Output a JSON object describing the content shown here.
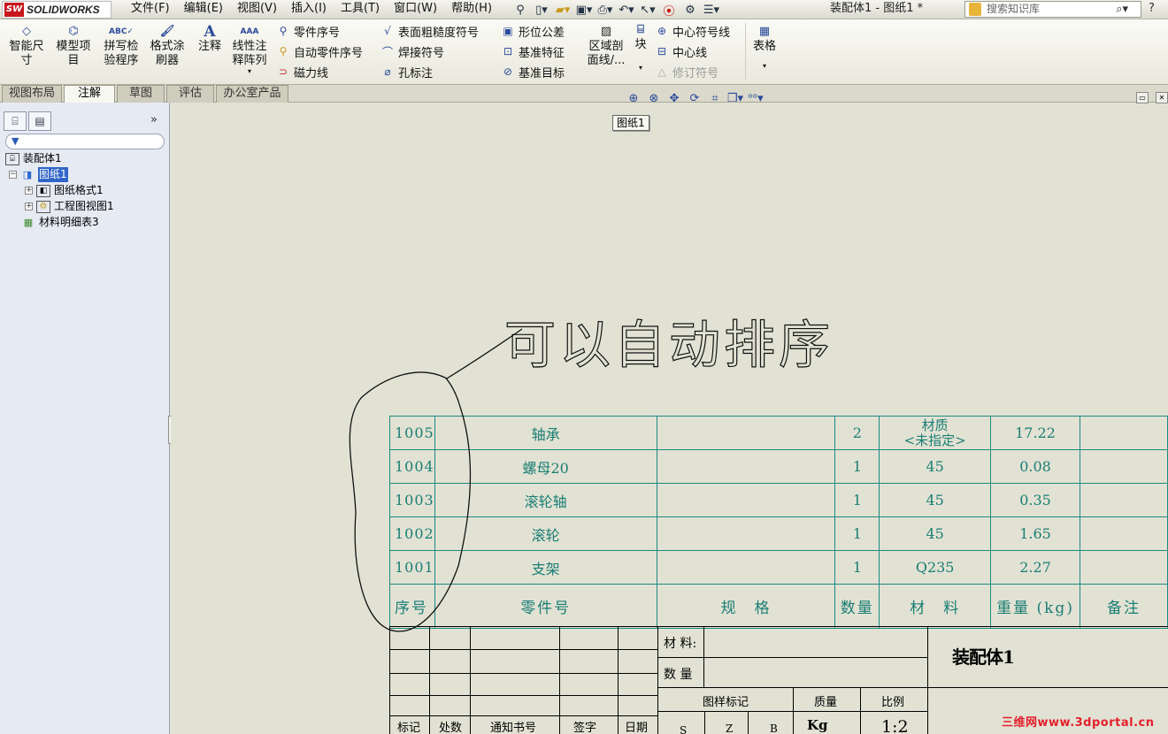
{
  "app": {
    "name": "SOLIDWORKS",
    "logo_badge": "SW"
  },
  "menu": [
    "文件(F)",
    "编辑(E)",
    "视图(V)",
    "插入(I)",
    "工具(T)",
    "窗口(W)",
    "帮助(H)"
  ],
  "quick_toolbar_icons": [
    "pin-icon",
    "new-document-icon",
    "open-icon",
    "save-icon",
    "print-icon",
    "undo-icon",
    "select-icon",
    "traffic-light-icon",
    "options-icon",
    "file-properties-icon"
  ],
  "document_title": "装配体1 - 图纸1 *",
  "search": {
    "placeholder": "搜索知识库"
  },
  "help_label": "?",
  "ribbon": {
    "smart_dimension": "智能尺\n寸",
    "model_items": "模型项\n目",
    "spell_checker": "拼写检\n验程序",
    "format_painter": "格式涂\n刷器",
    "note": "注释",
    "linear_note_pattern": "线性注\n释阵列",
    "balloon": "零件序号",
    "auto_balloon": "自动零件序号",
    "magnetic_line": "磁力线",
    "surface_finish": "表面粗糙度符号",
    "weld_symbol": "焊接符号",
    "hole_callout": "孔标注",
    "geometric_tolerance": "形位公差",
    "datum_feature": "基准特征",
    "datum_target": "基准目标",
    "area_hatch": "区域剖\n面线/...",
    "block": "块",
    "center_mark": "中心符号线",
    "centerline": "中心线",
    "revision_symbol": "修订符号",
    "table": "表格"
  },
  "tabs": [
    "视图布局",
    "注解",
    "草图",
    "评估",
    "办公室产品"
  ],
  "active_tab": "注解",
  "tree": {
    "root": "装配体1",
    "sheet": "图纸1",
    "sheet_format": "图纸格式1",
    "drawing_view": "工程图视图1",
    "bom": "材料明细表3"
  },
  "sheet_tooltip": "图纸1",
  "bom": {
    "rows": [
      {
        "no": "1005",
        "part": "轴承",
        "spec": "",
        "qty": "2",
        "material": "材质\n<未指定>",
        "weight": "17.22",
        "note": ""
      },
      {
        "no": "1004",
        "part": "螺母20",
        "spec": "",
        "qty": "1",
        "material": "45",
        "weight": "0.08",
        "note": ""
      },
      {
        "no": "1003",
        "part": "滚轮轴",
        "spec": "",
        "qty": "1",
        "material": "45",
        "weight": "0.35",
        "note": ""
      },
      {
        "no": "1002",
        "part": "滚轮",
        "spec": "",
        "qty": "1",
        "material": "45",
        "weight": "1.65",
        "note": ""
      },
      {
        "no": "1001",
        "part": "支架",
        "spec": "",
        "qty": "1",
        "material": "Q235",
        "weight": "2.27",
        "note": ""
      }
    ],
    "header": {
      "no": "序号",
      "part": "零件号",
      "spec": "规　格",
      "qty": "数量",
      "material": "材　料",
      "weight": "重量 (kg)",
      "note": "备注"
    }
  },
  "title_block": {
    "material_label": "材 料:",
    "quantity_label": "数 量",
    "drawing_name": "装配体1",
    "pattern_mark": "图样标记",
    "mass": "质量",
    "scale": "比例",
    "s": "S",
    "z": "Z",
    "b": "B",
    "mass_unit": "Kg",
    "scale_value": "1:2",
    "mark": "标记",
    "count": "处数",
    "notice_no": "通知书号",
    "sign": "签字",
    "date": "日期"
  },
  "annotation_text": "可以自动排序",
  "watermark": "三维网www.3dportal.cn"
}
